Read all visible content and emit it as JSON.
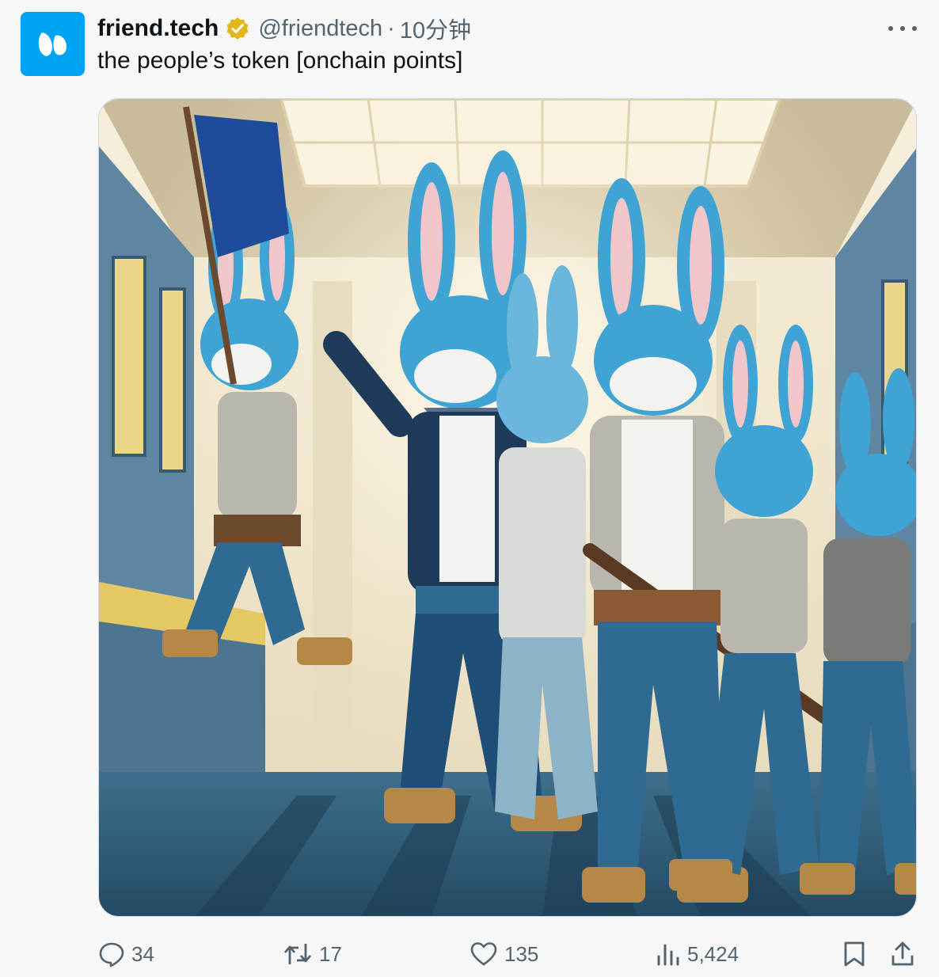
{
  "author": {
    "display_name": "friend.tech",
    "handle": "@friendtech",
    "separator": "·",
    "time": "10分钟",
    "verified": true,
    "avatar_color": "#00a3f2"
  },
  "tweet": {
    "text": "the people’s token [onchain points]"
  },
  "media": {
    "icon": "image-bank-heist-bunnies",
    "colors": {
      "bunny_blue": "#3fa4d4",
      "jeans": "#2f6a93",
      "wall": "#efe3c8",
      "floor": "#2f5b77"
    }
  },
  "actions": {
    "replies": "34",
    "retweets": "17",
    "likes": "135",
    "views": "5,424"
  },
  "colors": {
    "text_primary": "#0f1419",
    "text_secondary": "#536471",
    "verified_gold": "#e2b719"
  }
}
